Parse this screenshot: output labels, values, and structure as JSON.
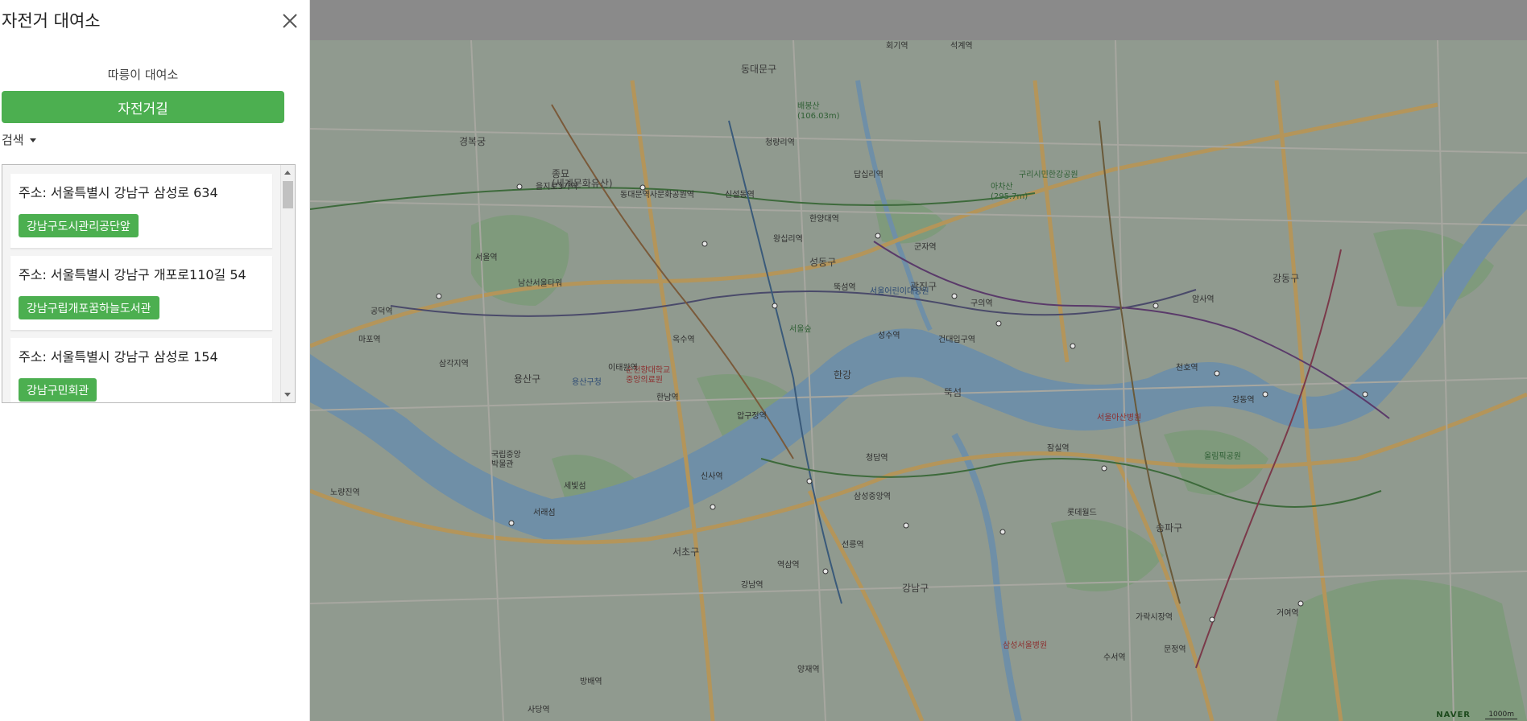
{
  "sidebar": {
    "title": "자전거 대여소",
    "close_icon": "close-icon",
    "station_type": "따릉이 대여소",
    "bike_road_label": "자전거길",
    "search_label": "검색",
    "stations": [
      {
        "address": "주소: 서울특별시 강남구 삼성로 634",
        "name": "강남구도시관리공단앞"
      },
      {
        "address": "주소: 서울특별시 강남구 개포로110길 54",
        "name": "강남구립개포꿈하늘도서관"
      },
      {
        "address": "주소: 서울특별시 강남구 삼성로 154",
        "name": "강남구민회관"
      }
    ]
  },
  "map": {
    "labels": {
      "gyeongbokgung": "경복궁",
      "jongmyo": "종묘\n(세계문화유산)",
      "seoul_station": "서울역",
      "namsan_tower": "남산서울타워",
      "yongsan_gu": "용산구",
      "yongsan_gucheong": "용산구청",
      "soonchunhyang": "순천향대학교\n중앙의료원",
      "seongdong_gu": "성동구",
      "seoul_forest": "서울숲",
      "gwangjin_gu": "광진구",
      "seoul_children_park": "서울어린이대공원",
      "acha_mountain": "아차산\n(295.7m)",
      "guri_tower": "구리시민한강공원",
      "dongdaemun_gu": "동대문구",
      "baebongsan": "배봉산\n(106.03m)",
      "hangang": "한강",
      "ttukseom": "뚝섬",
      "gangnam_gu": "강남구",
      "seocho_gu": "서초구",
      "songpa_gu": "송파구",
      "gangdong_gu": "강동구",
      "olympic_park": "올림픽공원",
      "lotte_world": "롯데월드",
      "seoul_asan": "서울아산병원",
      "samsung_hospital": "삼성서울병원",
      "national_museum": "국립중앙\n박물관",
      "seorae_island": "서래섬",
      "sebitseom": "세빛섬",
      "noryangjin": "노량진역",
      "sinsa": "신사역",
      "apgujeong": "압구정역",
      "cheongdam": "청담역",
      "samseong": "삼성중앙역",
      "seolleung": "선릉역",
      "yeoksam": "역삼역",
      "gangnam": "강남역",
      "kondae": "건대입구역",
      "seongsu": "성수역",
      "wangsimni": "왕십리역",
      "jamsil": "잠실역",
      "cheonho": "천호역",
      "gangdong": "강동역",
      "amsa": "암사역",
      "guui": "구의역",
      "gunja": "군자역",
      "oksu": "옥수역",
      "itaewon": "이태원역",
      "hannam": "한남역",
      "bangbae": "방배역",
      "sadang": "사당역",
      "yangjae": "양재역",
      "suseo": "수서역",
      "garak": "가락시장역",
      "munjeong": "문정역",
      "geoyeo": "거여역",
      "dapsimni": "답십리역",
      "cheongnyangni": "청량리역",
      "sinseol": "신설동역",
      "hanyang_univ": "한양대역",
      "ttukseom_station": "뚝섬역",
      "hoegi": "회기역",
      "seokgye": "석계역",
      "dongdaemun_history": "동대문역사문화공원역",
      "euljiro": "을지로3가역",
      "mapo": "마포역",
      "gongdeok": "공덕역",
      "samgakji": "삼각지역",
      "naver": "NAVER",
      "scale": "1000m"
    }
  }
}
